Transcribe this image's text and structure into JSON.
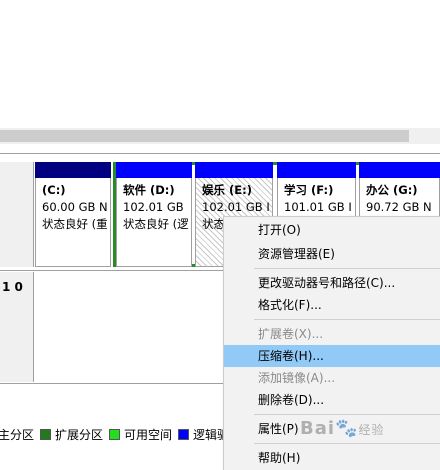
{
  "disk1": {
    "number": "1 0"
  },
  "volumes": [
    {
      "title": "(C:)",
      "size": "60.00 GB N",
      "status": "状态良好 (重",
      "bar_color": "#000080",
      "hatched": false
    },
    {
      "title": "软件 (D:)",
      "size": "102.01 GB",
      "status": "状态良好 (逻",
      "bar_color": "#0000ff",
      "hatched": false
    },
    {
      "title": "娱乐 (E:)",
      "size": "102.01 GB I",
      "status": "状态",
      "bar_color": "#0000ff",
      "hatched": true
    },
    {
      "title": "学习 (F:)",
      "size": "101.01 GB I",
      "status": "",
      "bar_color": "#0000ff",
      "hatched": false
    },
    {
      "title": "办公 (G:)",
      "size": "90.72 GB N",
      "status": "",
      "bar_color": "#0000ff",
      "hatched": false
    }
  ],
  "legend": [
    {
      "label": "主分区",
      "color": "#000080"
    },
    {
      "label": "扩展分区",
      "color": "#1f7a1f"
    },
    {
      "label": "可用空间",
      "color": "#22dd22"
    },
    {
      "label": "逻辑驱",
      "color": "#0000ff"
    }
  ],
  "context_menu": {
    "items": [
      {
        "label": "打开(O)",
        "enabled": true
      },
      {
        "label": "资源管理器(E)",
        "enabled": true
      },
      {
        "label": "更改驱动器号和路径(C)...",
        "enabled": true
      },
      {
        "label": "格式化(F)...",
        "enabled": true
      },
      {
        "label": "扩展卷(X)...",
        "enabled": false
      },
      {
        "label": "压缩卷(H)...",
        "enabled": true,
        "highlighted": true
      },
      {
        "label": "添加镜像(A)...",
        "enabled": false
      },
      {
        "label": "删除卷(D)...",
        "enabled": true
      },
      {
        "label": "属性(P)",
        "enabled": true
      },
      {
        "label": "帮助(H)",
        "enabled": true
      }
    ]
  },
  "watermark": {
    "brand": "Bai",
    "suffix": "经验"
  }
}
